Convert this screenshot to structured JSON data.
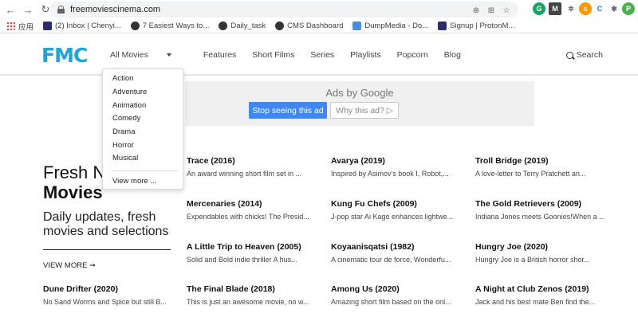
{
  "browser": {
    "url": "freemoviescinema.com",
    "bookmarks": [
      {
        "label": "应用",
        "color": "#e8453c"
      },
      {
        "label": "(2) Inbox | Chenyi...",
        "color": "#2d2d6e"
      },
      {
        "label": "7 Easiest Ways to...",
        "color": "#333333"
      },
      {
        "label": "Daily_task",
        "color": "#333333"
      },
      {
        "label": "CMS Dashboard",
        "color": "#333333"
      },
      {
        "label": "DumpMedia - Do...",
        "color": "#4a90d9"
      },
      {
        "label": "Signup | ProtonM...",
        "color": "#2d2d6e"
      }
    ],
    "profile_initial": "P"
  },
  "site": {
    "logo": "FMC",
    "nav": [
      "All Movies",
      "Features",
      "Short Films",
      "Series",
      "Playlists",
      "Popcorn",
      "Blog"
    ],
    "search_label": "Search"
  },
  "dropdown": {
    "items": [
      "Action",
      "Adventure",
      "Animation",
      "Comedy",
      "Drama",
      "Horror",
      "Musical"
    ],
    "view_more": "View more ..."
  },
  "ad": {
    "title": "Ads by Google",
    "stop_label": "Stop seeing this ad",
    "why_label": "Why this ad? ▷"
  },
  "hero": {
    "title_line1": "Fresh N",
    "title_line2": "Movies",
    "subtitle": "Daily updates, fresh movies and selections",
    "view_more": "VIEW MORE ➞"
  },
  "films": [
    {
      "title": "Trace (2016)",
      "desc": "An award winning short film set in ..."
    },
    {
      "title": "Avarya (2019)",
      "desc": "Inspired by Asimov's book I, Robot,..."
    },
    {
      "title": "Troll Bridge (2019)",
      "desc": "A love-letter to Terry Pratchett an..."
    },
    {
      "title": "Mercenaries (2014)",
      "desc": "Expendables with chicks! The Presid..."
    },
    {
      "title": "Kung Fu Chefs (2009)",
      "desc": "J-pop star Ai Kago enhances lightwe..."
    },
    {
      "title": "The Gold Retrievers (2009)",
      "desc": "Indiana Jones meets Goonies!When a ..."
    },
    {
      "title": "A Little Trip to Heaven (2005)",
      "desc": "Solid and Bold indie thriller A hus..."
    },
    {
      "title": "Koyaanisqatsi (1982)",
      "desc": "A cinematic tour de force, Wonderfu..."
    },
    {
      "title": "Hungry Joe (2020)",
      "desc": "Hungry Joe is a British horror shor..."
    },
    {
      "title": "Dune Drifter (2020)",
      "desc": "No Sand Worms and Spice but still B..."
    },
    {
      "title": "The Final Blade (2018)",
      "desc": "This is just an awesome movie, no w..."
    },
    {
      "title": "Among Us (2020)",
      "desc": "Amazing short film based on the onl..."
    },
    {
      "title": "A Night at Club Zenos (2019)",
      "desc": "Jack and his best mate Ben find the..."
    }
  ]
}
